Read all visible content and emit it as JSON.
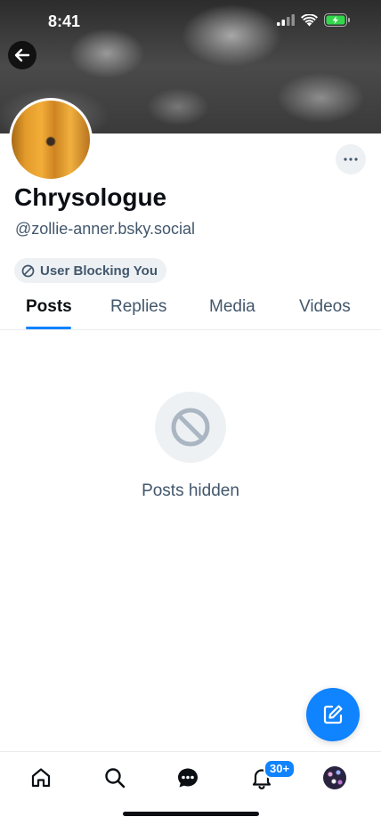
{
  "status_bar": {
    "time": "8:41"
  },
  "profile": {
    "display_name": "Chrysologue",
    "handle": "@zollie-anner.bsky.social",
    "block_label": "User Blocking You"
  },
  "tabs": [
    {
      "label": "Posts",
      "active": true
    },
    {
      "label": "Replies",
      "active": false
    },
    {
      "label": "Media",
      "active": false
    },
    {
      "label": "Videos",
      "active": false
    }
  ],
  "empty_state": {
    "text": "Posts hidden",
    "icon": "ban-icon"
  },
  "bottom_nav": {
    "items": [
      "home-icon",
      "search-icon",
      "chat-icon",
      "bell-icon",
      "profile-avatar"
    ],
    "notifications_badge": "30+"
  },
  "colors": {
    "accent": "#1083fe",
    "muted_text": "#42576c",
    "pill_bg": "#eef1f4"
  }
}
